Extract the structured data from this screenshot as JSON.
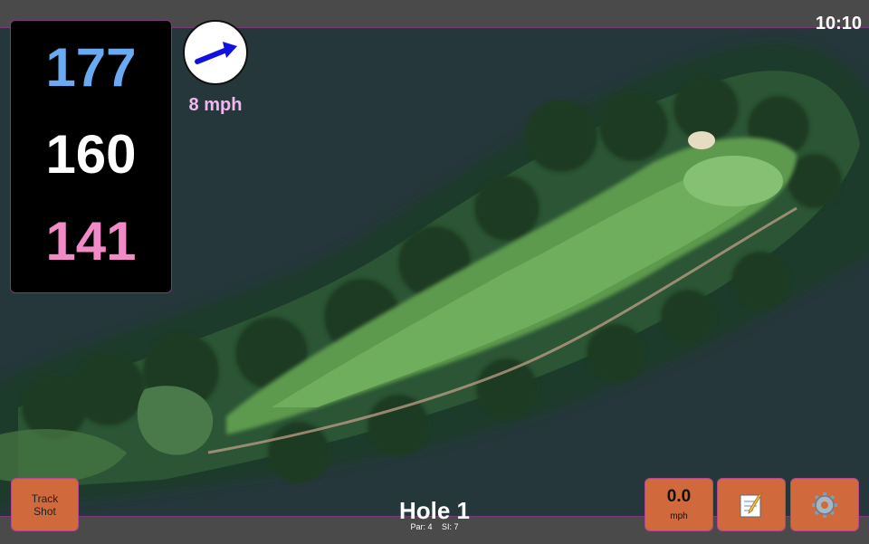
{
  "status": {
    "time": "10:10"
  },
  "distances": {
    "back": "177",
    "middle": "160",
    "front": "141"
  },
  "colors": {
    "back": "#6aaaf2",
    "middle": "#ffffff",
    "front": "#f28ac8",
    "wind_arrow": "#1010e0",
    "button": "#d0693c"
  },
  "wind": {
    "speed": "8 mph",
    "direction_icon": "arrow-icon"
  },
  "buttons": {
    "track_shot": "Track Shot",
    "speed_value": "0.0",
    "speed_unit": "mph",
    "notes_icon": "notepad-icon",
    "settings_icon": "gear-icon"
  },
  "hole": {
    "title": "Hole 1",
    "par": "Par: 4",
    "si": "SI: 7"
  }
}
